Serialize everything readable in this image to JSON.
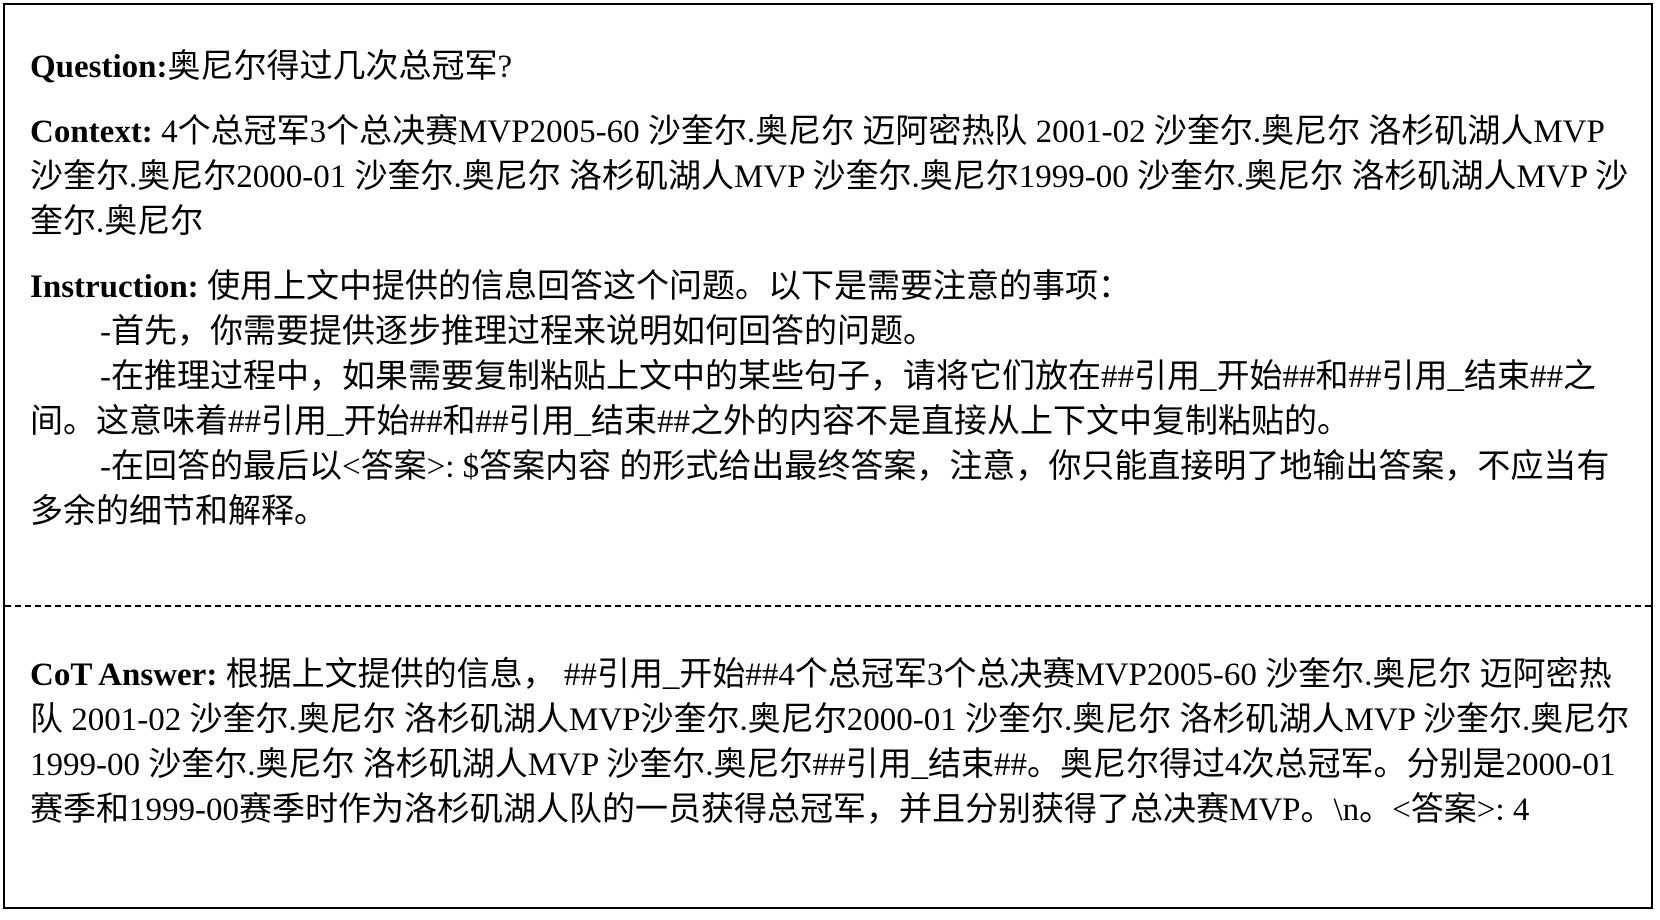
{
  "question": {
    "label": "Question:",
    "text": "奥尼尔得过几次总冠军?"
  },
  "context": {
    "label": "Context:",
    "text": "4个总冠军3个总决赛MVP2005-60 沙奎尔.奥尼尔 迈阿密热队 2001-02 沙奎尔.奥尼尔 洛杉矶湖人MVP沙奎尔.奥尼尔2000-01 沙奎尔.奥尼尔 洛杉矶湖人MVP 沙奎尔.奥尼尔1999-00 沙奎尔.奥尼尔 洛杉矶湖人MVP 沙奎尔.奥尼尔"
  },
  "instruction": {
    "label": "Instruction:",
    "text": "使用上文中提供的信息回答这个问题。以下是需要注意的事项：",
    "items": [
      "-首先，你需要提供逐步推理过程来说明如何回答的问题。",
      "-在推理过程中，如果需要复制粘贴上文中的某些句子，请将它们放在##引用_开始##和##引用_结束##之间。这意味着##引用_开始##和##引用_结束##之外的内容不是直接从上下文中复制粘贴的。",
      "-在回答的最后以<答案>: $答案内容 的形式给出最终答案，注意，你只能直接明了地输出答案，不应当有多余的细节和解释。"
    ]
  },
  "cot_answer": {
    "label": "CoT Answer:",
    "text": "根据上文提供的信息， ##引用_开始##4个总冠军3个总决赛MVP2005-60 沙奎尔.奥尼尔 迈阿密热队 2001-02 沙奎尔.奥尼尔 洛杉矶湖人MVP沙奎尔.奥尼尔2000-01 沙奎尔.奥尼尔 洛杉矶湖人MVP 沙奎尔.奥尼尔1999-00 沙奎尔.奥尼尔 洛杉矶湖人MVP 沙奎尔.奥尼尔##引用_结束##。奥尼尔得过4次总冠军。分别是2000-01赛季和1999-00赛季时作为洛杉矶湖人队的一员获得总冠军，并且分别获得了总决赛MVP。\\n。<答案>: 4"
  }
}
